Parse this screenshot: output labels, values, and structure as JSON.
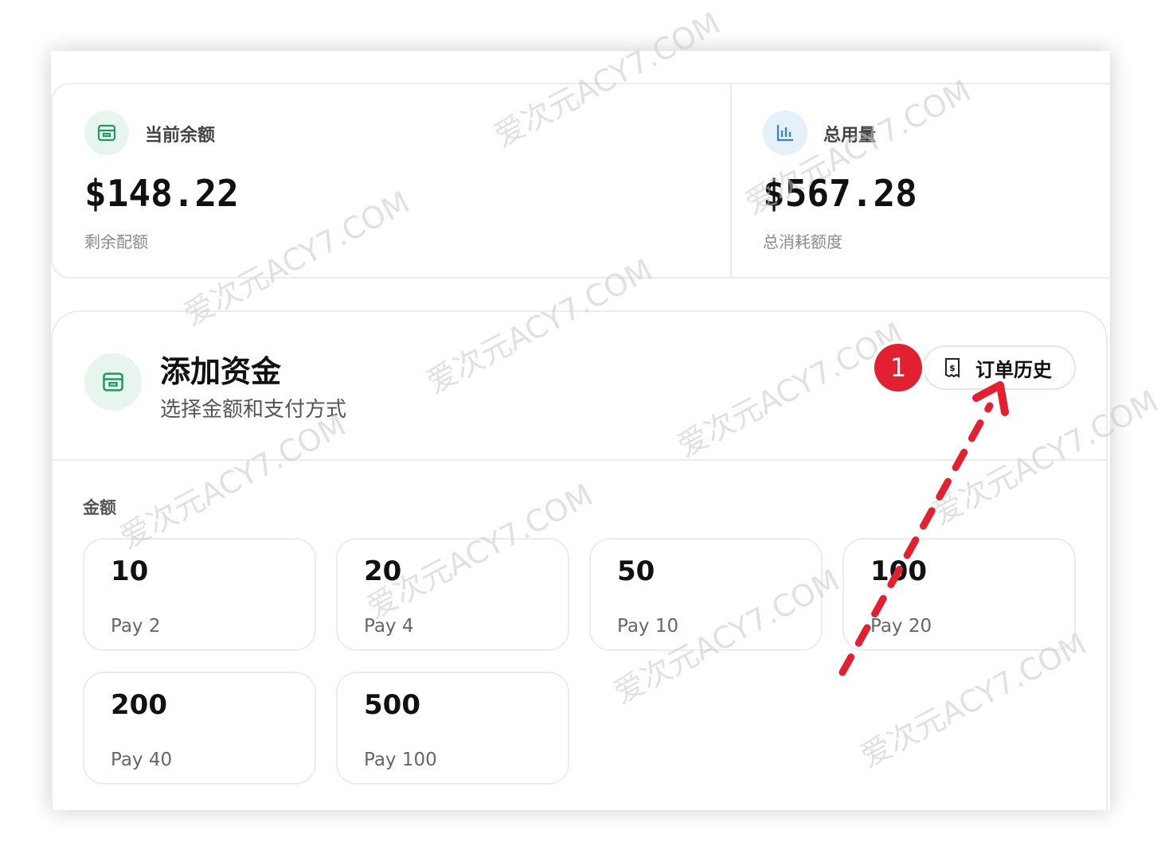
{
  "balance": {
    "label": "当前余额",
    "value": "$148.22",
    "sub": "剩余配额",
    "icon": "wallet-icon"
  },
  "usage": {
    "label": "总用量",
    "value": "$567.28",
    "sub": "总消耗额度",
    "icon": "bar-chart-icon"
  },
  "add_funds": {
    "title": "添加资金",
    "subtitle": "选择金额和支付方式",
    "icon": "wallet-icon",
    "history_button": "订单历史",
    "history_icon": "receipt-icon",
    "amount_label": "金额",
    "amounts": [
      {
        "amount": "10",
        "pay": "Pay 2"
      },
      {
        "amount": "20",
        "pay": "Pay 4"
      },
      {
        "amount": "50",
        "pay": "Pay 10"
      },
      {
        "amount": "100",
        "pay": "Pay 20"
      },
      {
        "amount": "200",
        "pay": "Pay 40"
      },
      {
        "amount": "500",
        "pay": "Pay 100"
      }
    ]
  },
  "annotation": {
    "step": "1",
    "color": "#e2202f"
  },
  "watermark": "爱次元ACY7.COM",
  "colors": {
    "accent_green": "#1e9a63",
    "accent_blue": "#2e86c8"
  }
}
